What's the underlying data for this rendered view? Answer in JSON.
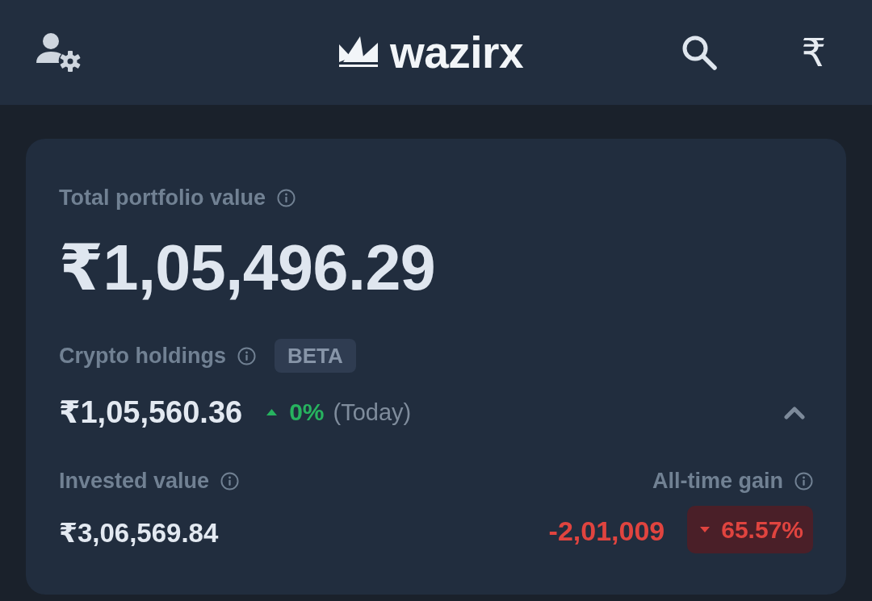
{
  "header": {
    "brand": "wazirx",
    "currency_button": "₹"
  },
  "portfolio": {
    "label": "Total portfolio value",
    "value": "₹1,05,496.29"
  },
  "crypto_holdings": {
    "label": "Crypto holdings",
    "badge": "BETA",
    "value": "₹1,05,560.36",
    "change": "0%",
    "negative": false,
    "period": "(Today)",
    "expanded": true
  },
  "invested": {
    "label": "Invested value",
    "value": "₹3,06,569.84"
  },
  "all_time_gain": {
    "label": "All-time gain",
    "amount": "-2,01,009",
    "percent": "65.57%",
    "negative": true
  }
}
